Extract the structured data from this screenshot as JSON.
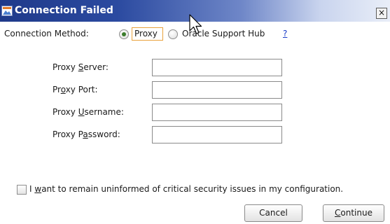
{
  "window": {
    "title": "Connection Failed",
    "close_glyph": "×"
  },
  "connection_method": {
    "label": "Connection Method:",
    "options": [
      {
        "label": "Proxy",
        "selected": true
      },
      {
        "label": "Oracle Support Hub",
        "selected": false
      }
    ],
    "help_text": "?"
  },
  "fields": [
    {
      "pre": "Proxy ",
      "mn": "S",
      "post": "erver:",
      "value": ""
    },
    {
      "pre": "Pr",
      "mn": "o",
      "post": "xy Port:",
      "value": ""
    },
    {
      "pre": "Proxy ",
      "mn": "U",
      "post": "sername:",
      "value": ""
    },
    {
      "pre": "Proxy P",
      "mn": "a",
      "post": "ssword:",
      "value": ""
    }
  ],
  "security_opt_out": {
    "pre": "I ",
    "mn": "w",
    "post": "ant to remain uninformed of critical security issues in my configuration.",
    "checked": false
  },
  "buttons": {
    "cancel": "Cancel",
    "continue_mn": "C",
    "continue_rest": "ontinue"
  },
  "icons": [
    "app-icon",
    "close-icon",
    "cursor-arrow-icon"
  ],
  "colors": {
    "titlebar_start": "#1f3a8a",
    "titlebar_end": "#e9eef8",
    "focus_outline": "#e9a23b",
    "radio_dot": "#3b7d2c",
    "link": "#1a3cc8"
  }
}
